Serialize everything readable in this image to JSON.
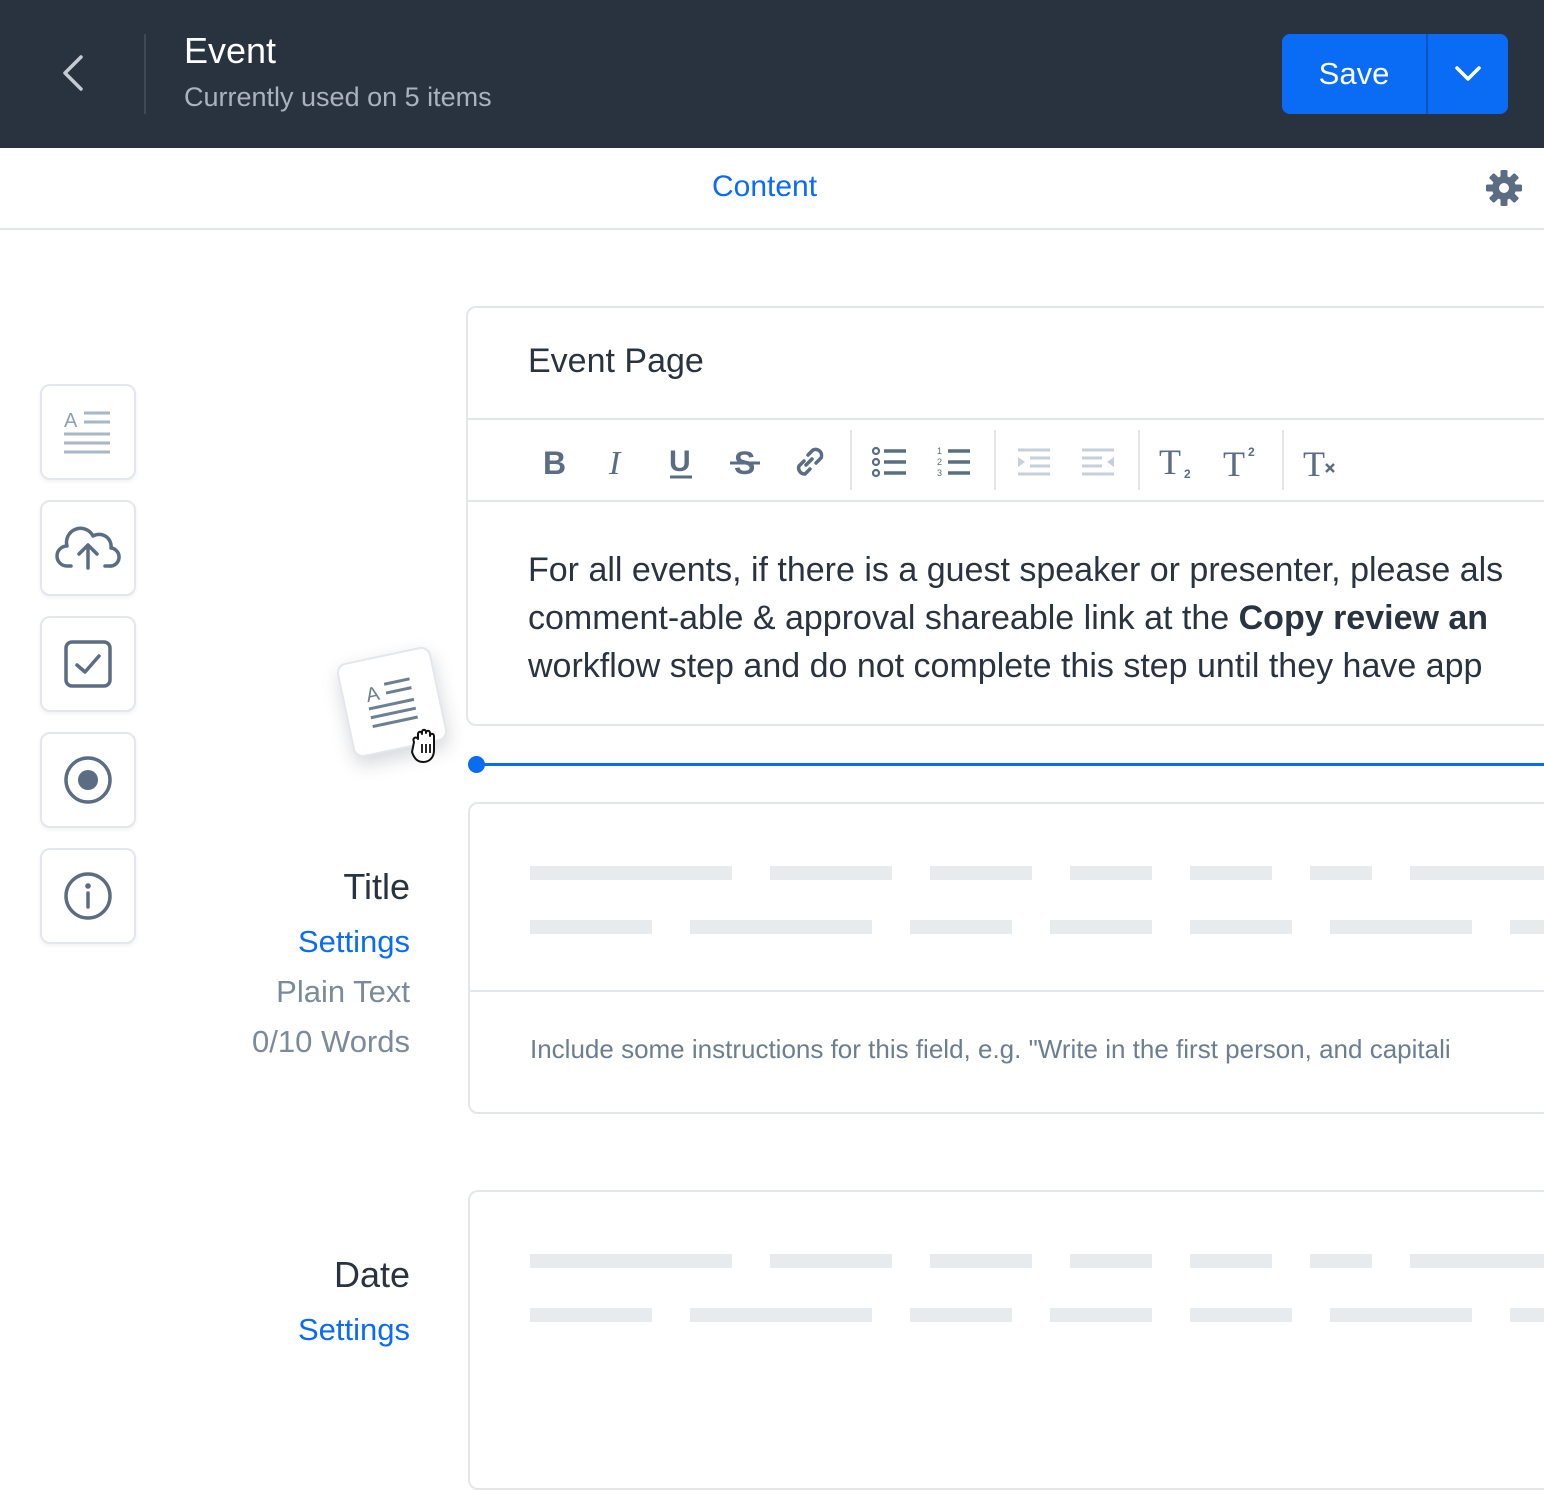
{
  "header": {
    "title": "Event",
    "subtitle": "Currently used on 5 items",
    "save_label": "Save"
  },
  "tabs": {
    "content_label": "Content"
  },
  "palette": [
    "text-block-icon",
    "cloud-upload-icon",
    "checkbox-icon",
    "radio-icon",
    "info-icon"
  ],
  "rich_text_card": {
    "title": "Event Page",
    "toolbar": [
      "bold",
      "italic",
      "underline",
      "strikethrough",
      "link",
      "bullet-list",
      "numbered-list",
      "outdent",
      "indent",
      "subscript",
      "superscript",
      "clear-format"
    ],
    "line1": "For all events, if there is a guest speaker or presenter, please als",
    "line2_before": "comment-able & approval shareable link at the ",
    "line2_bold": "Copy review an",
    "line3": "workflow step and do not complete this step until they have app"
  },
  "title_field": {
    "label": "Title",
    "settings_label": "Settings",
    "type": "Plain Text",
    "word_count": "0/10 Words",
    "instructions": "Include some instructions for this field, e.g. \"Write in the first person, and capitali"
  },
  "date_field": {
    "label": "Date",
    "settings_label": "Settings"
  },
  "colors": {
    "accent": "#0a6cf5",
    "header_bg": "#29333f",
    "icon": "#5a6d83"
  }
}
